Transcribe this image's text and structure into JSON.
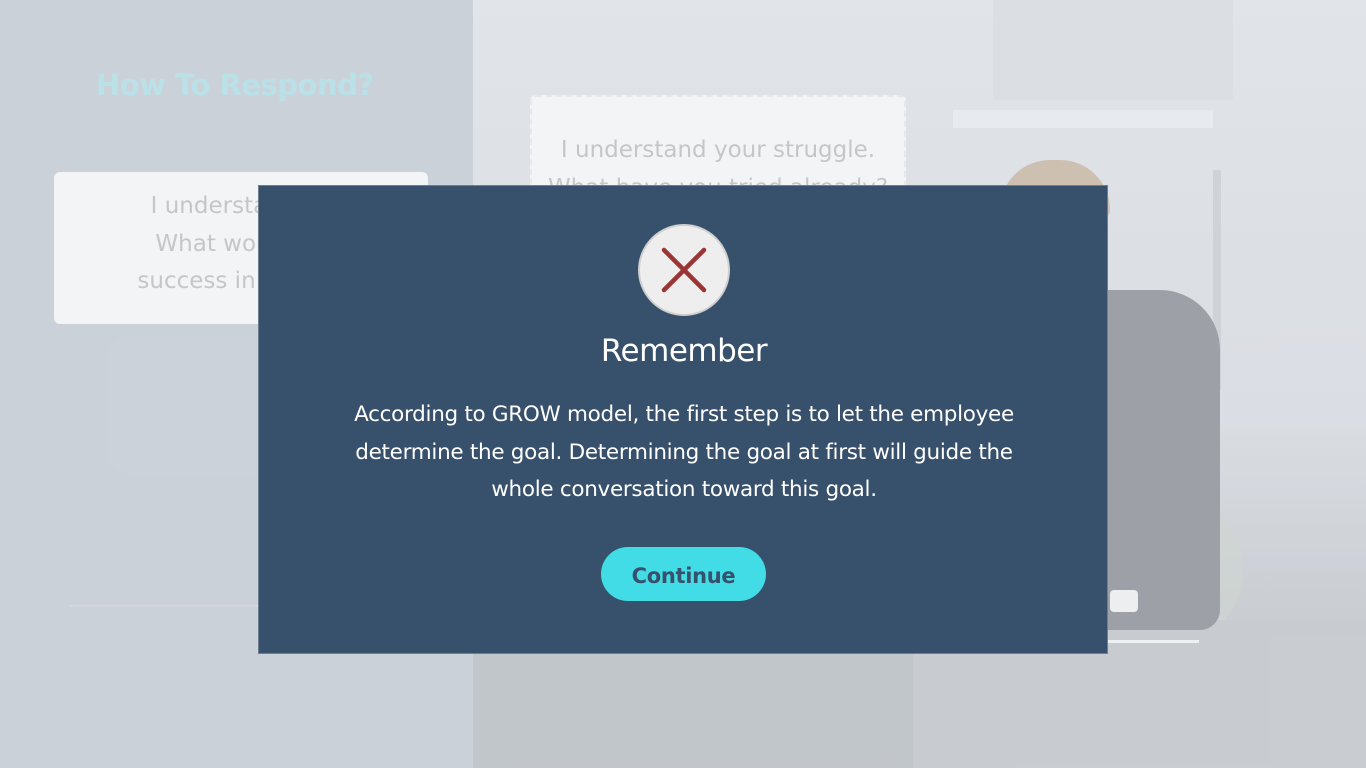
{
  "background": {
    "heading": "How To Respond?",
    "option_left_lines": [
      "I understand yo",
      "What would yo",
      "success in solving"
    ],
    "option_right_lines": [
      "I understand your struggle.",
      "What have you tried already?"
    ]
  },
  "modal": {
    "icon": "close-icon",
    "title": "Remember",
    "body": "According to GROW model, the first step is to let the employee determine the goal. Determining the goal at first will guide the whole conversation toward this goal.",
    "continue_label": "Continue"
  },
  "colors": {
    "modal_bg": "#37506b",
    "accent": "#41dce5",
    "error_x": "#9b3535",
    "heading": "#b8e3ea"
  }
}
